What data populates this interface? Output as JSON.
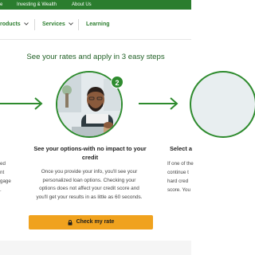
{
  "topbar": {
    "items": [
      {
        "label": "e"
      },
      {
        "label": "Investing & Wealth"
      },
      {
        "label": "About Us"
      }
    ]
  },
  "nav": {
    "items": [
      {
        "label": "roducts"
      },
      {
        "label": "Services"
      },
      {
        "label": "Learning"
      }
    ]
  },
  "hero": {
    "title": "See your rates and apply in 3 easy steps"
  },
  "steps": {
    "current_badge": "2",
    "title_line1": "See your options-with no impact to your",
    "title_line2": "credit",
    "description_lines": [
      "Once you provide your info, you'll see your",
      "personalized loan options. Checking your",
      "options does not affect your credit score and",
      "you'll get your results in as little as 60 seconds."
    ],
    "left_fragments": [
      "ed",
      "nt",
      "gage",
      "."
    ],
    "right_title": "Select a",
    "right_fragments": [
      "If one of the",
      "continue t",
      "hard cred",
      "score. You"
    ]
  },
  "cta": {
    "label": "Check my rate"
  },
  "colors": {
    "brand_green": "#2b7d2e",
    "accent_orange": "#f0a21e",
    "heading_green": "#1f5f24"
  }
}
